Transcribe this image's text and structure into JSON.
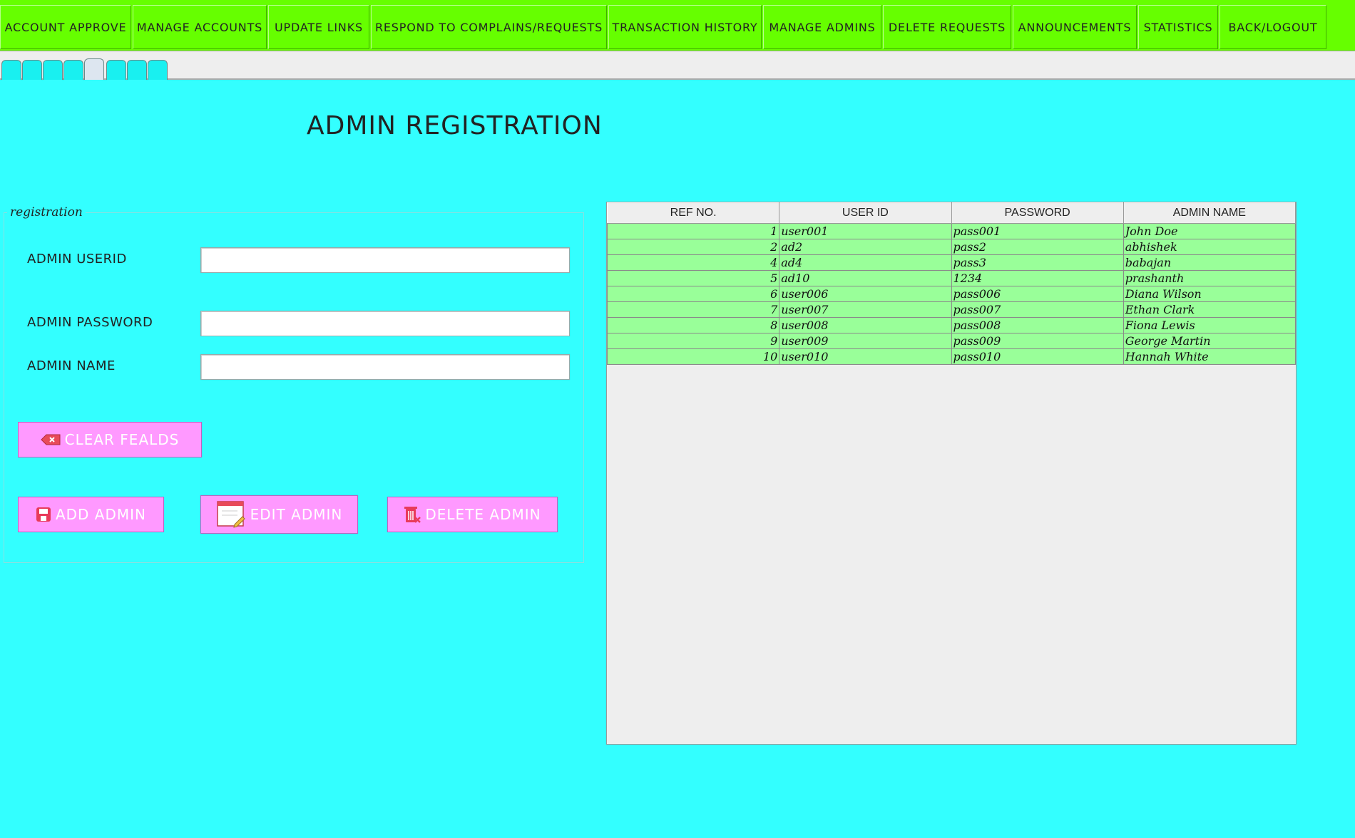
{
  "menu": [
    {
      "label": "ACCOUNT APPROVE"
    },
    {
      "label": "MANAGE ACCOUNTS"
    },
    {
      "label": "UPDATE LINKS"
    },
    {
      "label": "RESPOND TO COMPLAINS/REQUESTS"
    },
    {
      "label": "TRANSACTION HISTORY"
    },
    {
      "label": "MANAGE ADMINS"
    },
    {
      "label": "DELETE REQUESTS"
    },
    {
      "label": "ANNOUNCEMENTS"
    },
    {
      "label": "STATISTICS"
    },
    {
      "label": "BACK/LOGOUT"
    }
  ],
  "tabs": {
    "count": 8,
    "selected_index": 4
  },
  "page": {
    "title": "ADMIN REGISTRATION"
  },
  "form": {
    "legend": "registration",
    "userid_label": "ADMIN USERID",
    "userid_value": "",
    "password_label": "ADMIN PASSWORD",
    "password_value": "",
    "name_label": "ADMIN NAME",
    "name_value": ""
  },
  "buttons": {
    "clear": "CLEAR FEALDS",
    "add": "ADD ADMIN",
    "edit": "EDIT ADMIN",
    "delete": "DELETE ADMIN"
  },
  "table": {
    "headers": [
      "REF NO.",
      "USER ID",
      "PASSWORD",
      "ADMIN NAME"
    ],
    "rows": [
      [
        "1",
        "user001",
        "pass001",
        "John Doe"
      ],
      [
        "2",
        "ad2",
        "pass2",
        "abhishek"
      ],
      [
        "4",
        "ad4",
        "pass3",
        "babajan"
      ],
      [
        "5",
        "ad10",
        "1234",
        "prashanth"
      ],
      [
        "6",
        "user006",
        "pass006",
        "Diana Wilson"
      ],
      [
        "7",
        "user007",
        "pass007",
        "Ethan Clark"
      ],
      [
        "8",
        "user008",
        "pass008",
        "Fiona Lewis"
      ],
      [
        "9",
        "user009",
        "pass009",
        "George Martin"
      ],
      [
        "10",
        "user010",
        "pass010",
        "Hannah White"
      ]
    ]
  },
  "colors": {
    "background": "#33ffff",
    "menu": "#66ff00",
    "button": "#ff99ff",
    "row": "#99ff99"
  },
  "icons": {
    "clear": "eraser-icon",
    "add": "floppy-disk-icon",
    "edit": "edit-page-icon",
    "delete": "trash-icon"
  }
}
